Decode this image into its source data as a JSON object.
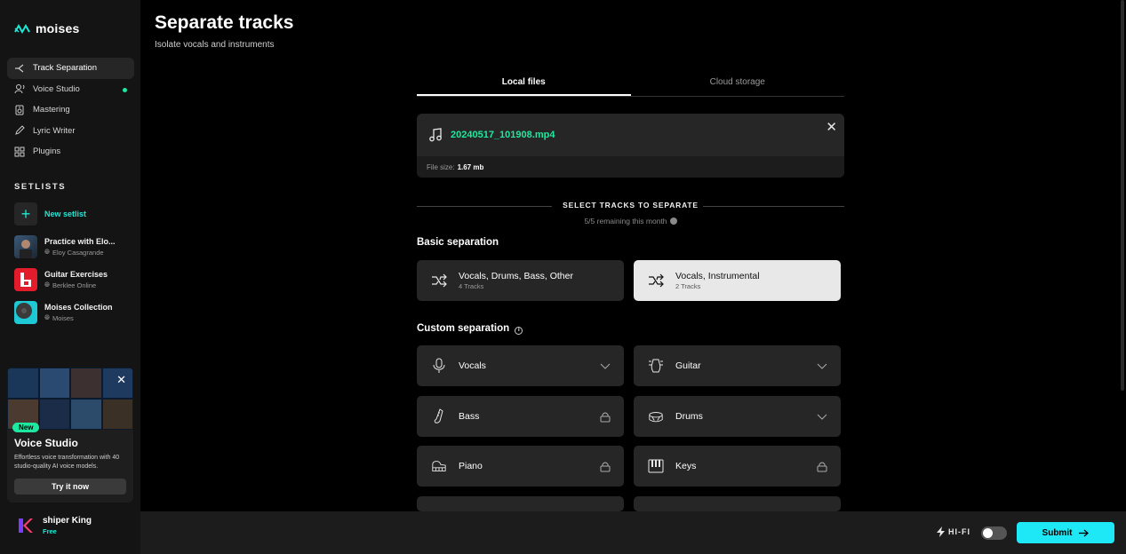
{
  "app": {
    "logo_text": "moises"
  },
  "sidebar": {
    "nav": [
      {
        "label": "Track Separation",
        "icon": "split-icon",
        "active": true
      },
      {
        "label": "Voice Studio",
        "icon": "voice-icon",
        "dot": true
      },
      {
        "label": "Mastering",
        "icon": "speaker-icon"
      },
      {
        "label": "Lyric Writer",
        "icon": "pen-icon"
      },
      {
        "label": "Plugins",
        "icon": "grid-icon"
      }
    ],
    "setlists_title": "SETLISTS",
    "new_setlist": "New setlist",
    "setlists": [
      {
        "title": "Practice with Elo...",
        "owner": "Eloy Casagrande"
      },
      {
        "title": "Guitar Exercises",
        "owner": "Berklee Online"
      },
      {
        "title": "Moises Collection",
        "owner": "Moises"
      }
    ],
    "promo": {
      "badge": "New",
      "title": "Voice Studio",
      "description": "Effortless voice transformation with 40 studio-quality AI voice models.",
      "button": "Try it now"
    },
    "user": {
      "name": "shiper King",
      "plan": "Free"
    }
  },
  "main": {
    "title": "Separate tracks",
    "subtitle": "Isolate vocals and instruments",
    "tabs": [
      {
        "label": "Local files",
        "active": true
      },
      {
        "label": "Cloud storage"
      }
    ],
    "file": {
      "name": "20240517_101908.mp4",
      "size_label": "File size:",
      "size_value": "1.67 mb"
    },
    "select_title": "SELECT TRACKS TO SEPARATE",
    "remaining": "5/5 remaining this month",
    "basic_title": "Basic separation",
    "basic": [
      {
        "label": "Vocals, Drums, Bass, Other",
        "sub": "4 Tracks",
        "selected": false
      },
      {
        "label": "Vocals, Instrumental",
        "sub": "2 Tracks",
        "selected": true
      }
    ],
    "custom_title": "Custom separation",
    "custom": [
      {
        "label": "Vocals",
        "icon": "microphone-icon",
        "right": "chevron"
      },
      {
        "label": "Guitar",
        "icon": "guitar-icon",
        "right": "chevron"
      },
      {
        "label": "Bass",
        "icon": "bass-icon",
        "right": "lock"
      },
      {
        "label": "Drums",
        "icon": "drum-icon",
        "right": "chevron"
      },
      {
        "label": "Piano",
        "icon": "piano-icon",
        "right": "lock"
      },
      {
        "label": "Keys",
        "icon": "keys-icon",
        "right": "lock"
      }
    ]
  },
  "bottom": {
    "hifi": "HI-FI",
    "hifi_on": false,
    "submit": "Submit"
  },
  "colors": {
    "accent": "#1ee8f5",
    "green": "#1ee8a0"
  }
}
